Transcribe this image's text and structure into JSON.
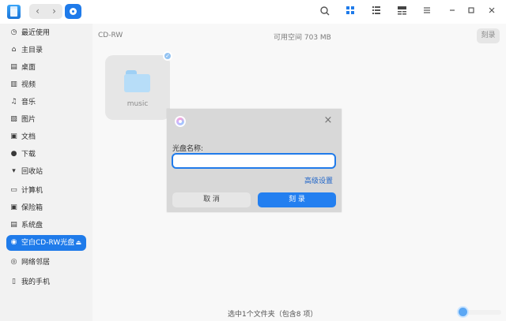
{
  "toolbar": {
    "back_symbol": "‹",
    "forward_symbol": "›",
    "icons": [
      "search-icon",
      "grid-view-icon",
      "list-view-icon",
      "details-view-icon",
      "menu-icon",
      "minimize-icon",
      "maximize-icon",
      "close-window-icon"
    ]
  },
  "sidebar": {
    "items": [
      {
        "label": "最近使用",
        "icon": "recent-icon"
      },
      {
        "label": "主目录",
        "icon": "home-icon"
      },
      {
        "label": "桌面",
        "icon": "desktop-icon"
      },
      {
        "label": "视频",
        "icon": "video-icon"
      },
      {
        "label": "音乐",
        "icon": "music-icon"
      },
      {
        "label": "图片",
        "icon": "pictures-icon"
      },
      {
        "label": "文档",
        "icon": "documents-icon"
      },
      {
        "label": "下载",
        "icon": "download-icon"
      },
      {
        "label": "回收站",
        "icon": "trash-icon"
      },
      {
        "label": "计算机",
        "icon": "computer-icon"
      },
      {
        "label": "保险箱",
        "icon": "vault-icon"
      },
      {
        "label": "系统盘",
        "icon": "system-disk-icon"
      },
      {
        "label": "空白CD-RW光盘",
        "icon": "cd-icon",
        "selected": true
      },
      {
        "label": "网络邻居",
        "icon": "network-icon"
      },
      {
        "label": "我的手机",
        "icon": "phone-icon"
      }
    ]
  },
  "content": {
    "disc_type": "CD-RW",
    "free_space": "可用空间 703 MB",
    "burn_button": "刻录",
    "file_name": "music",
    "status": "选中1个文件夹（包含8 项）"
  },
  "dialog": {
    "label": "光盘名称:",
    "input_value": "",
    "advanced_link": "高级设置",
    "cancel_button": "取 消",
    "burn_button": "刻 录"
  },
  "colors": {
    "accent": "#1f7bea",
    "sidebar_bg": "#f2f2f2",
    "dialog_bg": "#d8d8d8"
  }
}
